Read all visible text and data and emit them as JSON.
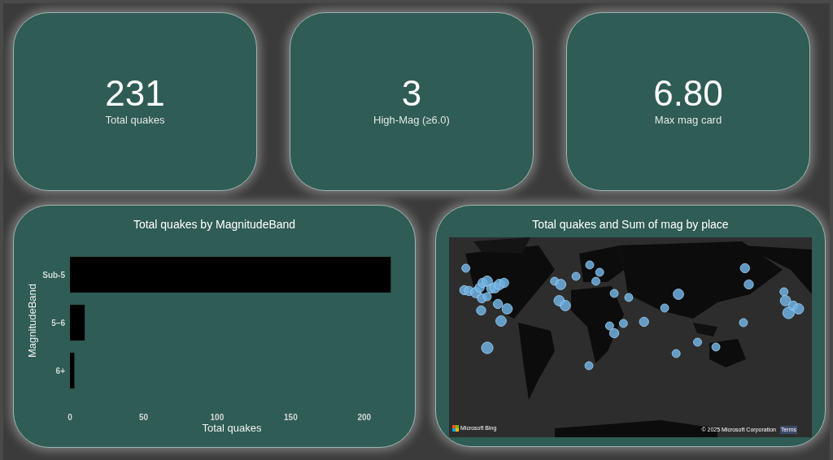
{
  "kpi_cards": [
    {
      "value": "231",
      "label": "Total quakes"
    },
    {
      "value": "3",
      "label": "High-Mag (≥6.0)"
    },
    {
      "value": "6.80",
      "label": "Max mag card"
    }
  ],
  "bar_panel": {
    "title": "Total quakes by MagnitudeBand",
    "chart_data": {
      "type": "bar",
      "orientation": "horizontal",
      "xlabel": "Total quakes",
      "ylabel": "MagnitudeBand",
      "categories": [
        "Sub-5",
        "5–6",
        "6+"
      ],
      "values": [
        218,
        10,
        3
      ],
      "xlim": [
        0,
        220
      ],
      "xticks": [
        0,
        50,
        100,
        150,
        200
      ]
    }
  },
  "map_panel": {
    "title": "Total quakes and Sum of mag by place",
    "logo_text": "Microsoft Bing",
    "copyright": "© 2025 Microsoft Corporation",
    "terms_link": "Terms"
  }
}
